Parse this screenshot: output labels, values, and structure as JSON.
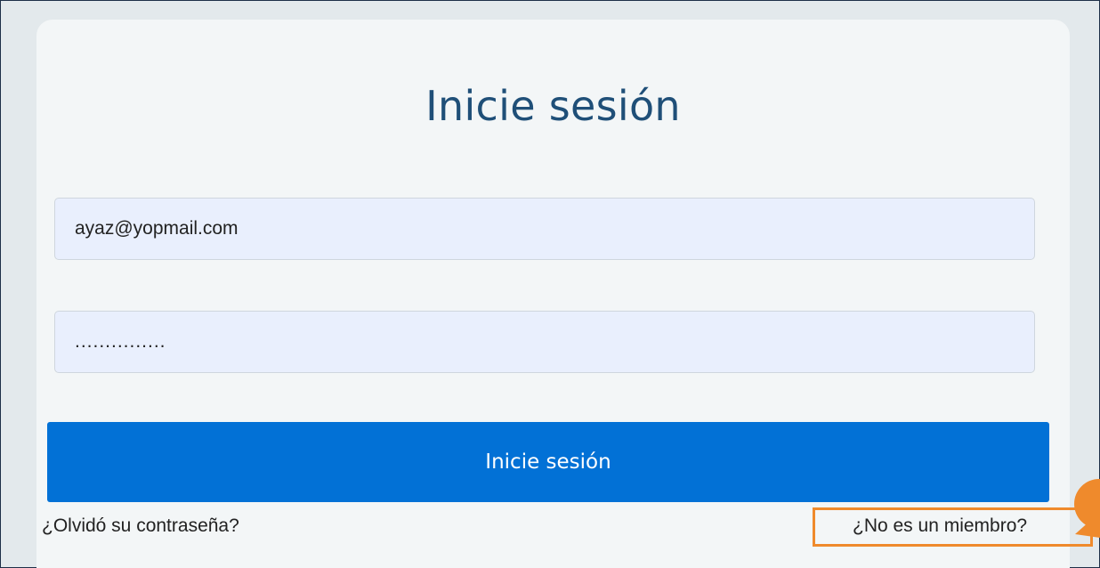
{
  "login": {
    "title": "Inicie sesión",
    "email_value": "ayaz@yopmail.com",
    "password_value": "...............",
    "submit_label": "Inicie sesión",
    "forgot_label": "¿Olvidó su contraseña?",
    "member_label": "¿No es un miembro?"
  },
  "colors": {
    "title": "#1f4f78",
    "primary_button": "#0271d6",
    "input_bg": "#e9effd",
    "card_bg": "#f3f6f7",
    "callout": "#ef8a2c"
  }
}
